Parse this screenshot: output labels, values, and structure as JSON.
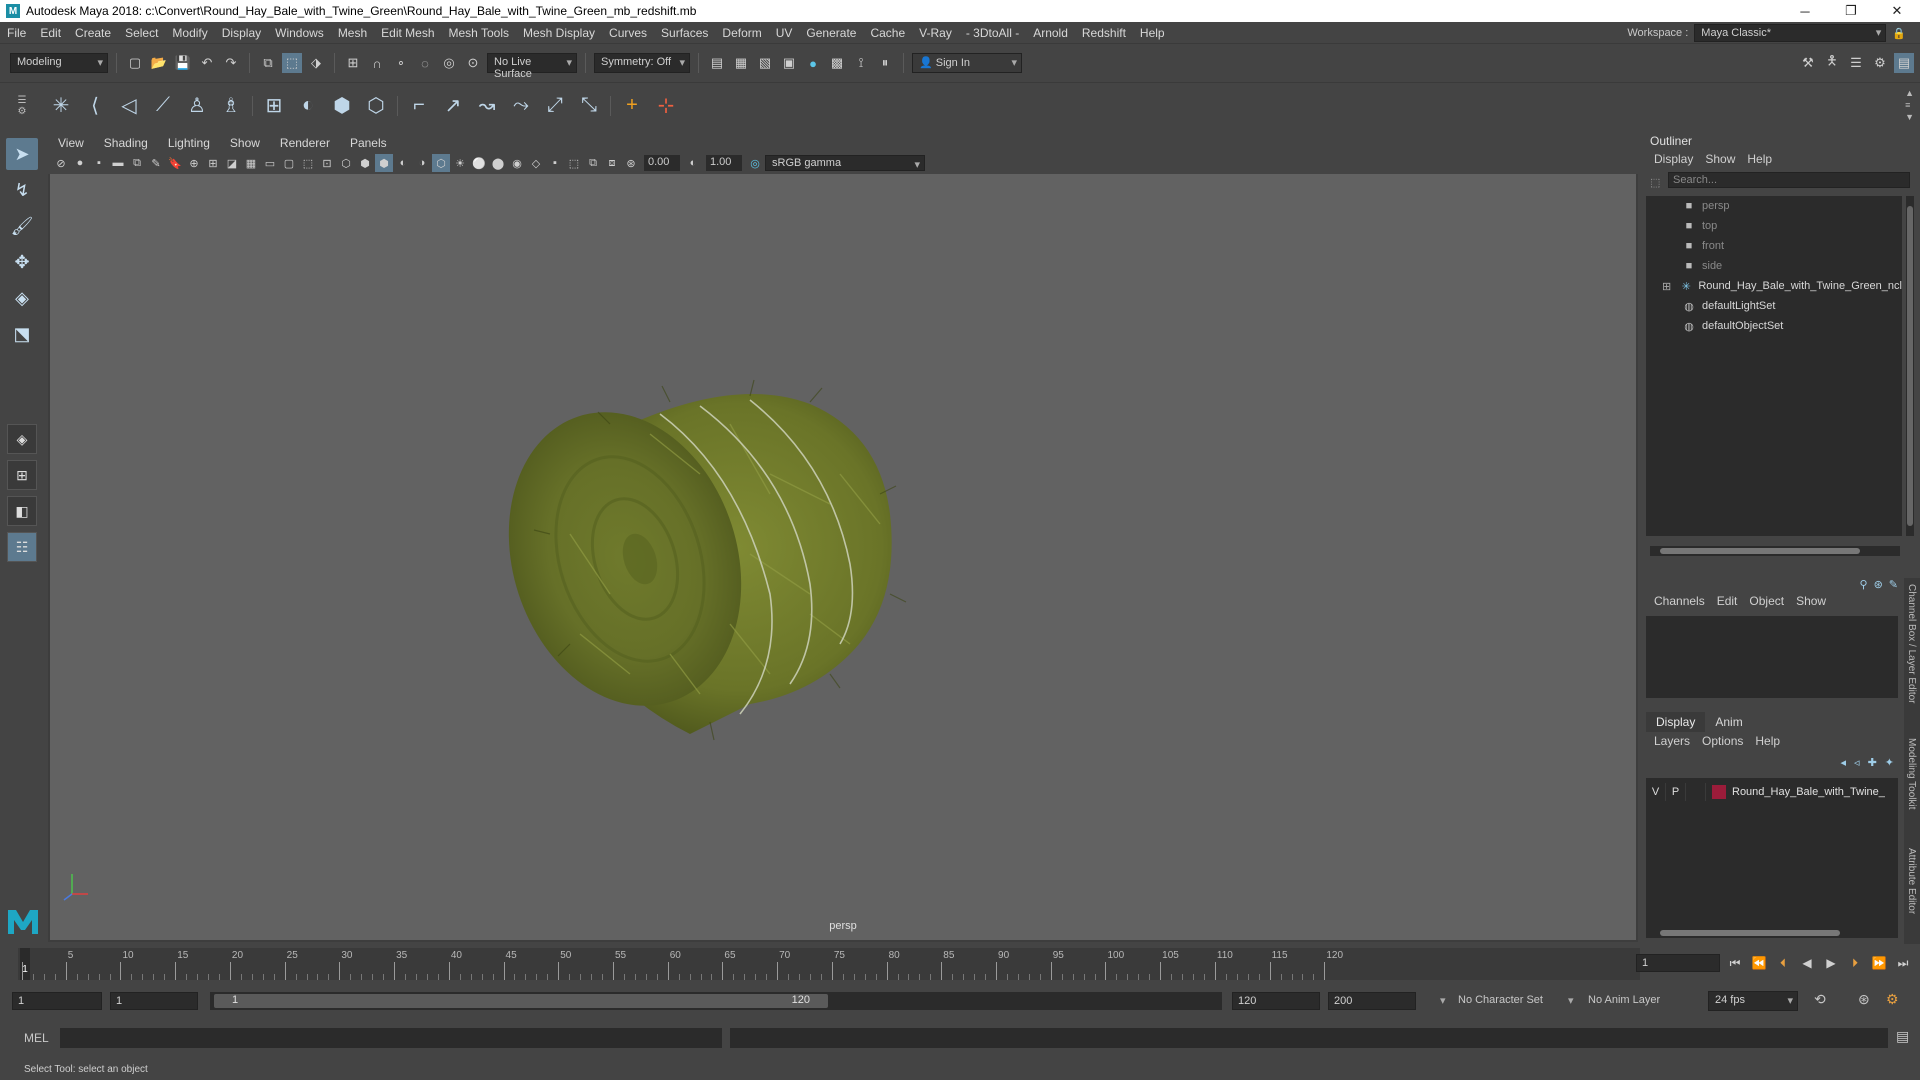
{
  "window": {
    "title": "Autodesk Maya 2018: c:\\Convert\\Round_Hay_Bale_with_Twine_Green\\Round_Hay_Bale_with_Twine_Green_mb_redshift.mb",
    "logo": "M",
    "minimize": "─",
    "maximize": "❐",
    "close": "✕"
  },
  "menubar": {
    "items": [
      "File",
      "Edit",
      "Create",
      "Select",
      "Modify",
      "Display",
      "Windows",
      "Mesh",
      "Edit Mesh",
      "Mesh Tools",
      "Mesh Display",
      "Curves",
      "Surfaces",
      "Deform",
      "UV",
      "Generate",
      "Cache",
      "V-Ray",
      "- 3DtoAll -",
      "Arnold",
      "Redshift",
      "Help"
    ],
    "workspace_label": "Workspace :",
    "workspace_value": "Maya Classic*"
  },
  "statusline": {
    "mode": "Modeling",
    "live_surface": "No Live Surface",
    "symmetry": "Symmetry: Off",
    "sign_in": "Sign In"
  },
  "viewport": {
    "menu": [
      "View",
      "Shading",
      "Lighting",
      "Show",
      "Renderer",
      "Panels"
    ],
    "exposure": "0.00",
    "gamma": "1.00",
    "color_space": "sRGB gamma",
    "camera_label": "persp"
  },
  "outliner": {
    "title": "Outliner",
    "menu": [
      "Display",
      "Show",
      "Help"
    ],
    "search_placeholder": "Search...",
    "items": [
      {
        "label": "persp",
        "icon": "camera-icon",
        "dim": true
      },
      {
        "label": "top",
        "icon": "camera-icon",
        "dim": true
      },
      {
        "label": "front",
        "icon": "camera-icon",
        "dim": true
      },
      {
        "label": "side",
        "icon": "camera-icon",
        "dim": true
      },
      {
        "label": "Round_Hay_Bale_with_Twine_Green_ncl",
        "icon": "transform-icon",
        "dim": false
      },
      {
        "label": "defaultLightSet",
        "icon": "set-icon",
        "dim": false
      },
      {
        "label": "defaultObjectSet",
        "icon": "set-icon",
        "dim": false
      }
    ]
  },
  "channelbox": {
    "menu": [
      "Channels",
      "Edit",
      "Object",
      "Show"
    ]
  },
  "layereditor": {
    "tabs": [
      "Display",
      "Anim"
    ],
    "menu": [
      "Layers",
      "Options",
      "Help"
    ],
    "layer": {
      "v": "V",
      "p": "P",
      "name": "Round_Hay_Bale_with_Twine_",
      "color": "#9b1c3a"
    }
  },
  "side_tabs": [
    "Channel Box / Layer Editor",
    "Modeling Toolkit",
    "Attribute Editor"
  ],
  "timeslider": {
    "ticks": [
      "1",
      "5",
      "10",
      "15",
      "20",
      "25",
      "30",
      "35",
      "40",
      "45",
      "50",
      "55",
      "60",
      "65",
      "70",
      "75",
      "80",
      "85",
      "90",
      "95",
      "100",
      "105",
      "110",
      "115",
      "120"
    ],
    "current_frame": "1",
    "current_field": "1"
  },
  "rangeslider": {
    "start": "1",
    "start2": "1",
    "range_start": "1",
    "range_end": "120",
    "end": "120",
    "end2": "200",
    "character_set": "No Character Set",
    "anim_layer": "No Anim Layer",
    "fps": "24 fps"
  },
  "cmdline": {
    "label": "MEL"
  },
  "helpline": {
    "text": "Select Tool: select an object"
  },
  "colors": {
    "hay": "#6f7a2a",
    "accent": "#5d7a8f"
  }
}
